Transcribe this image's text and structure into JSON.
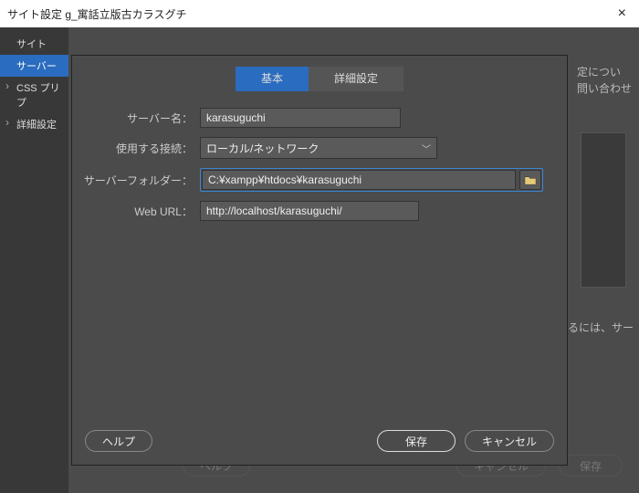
{
  "title": "サイト設定 g_寓話立版古カラスグチ",
  "sidebar": {
    "items": [
      {
        "label": "サイト"
      },
      {
        "label": "サーバー"
      },
      {
        "label": "CSS プリプ"
      },
      {
        "label": "詳細設定"
      }
    ]
  },
  "bg": {
    "line1": "定につい",
    "line2": "問い合わせ",
    "line3": "するには、サー",
    "help": "ヘルプ",
    "cancel": "キャンセル",
    "save": "保存"
  },
  "tabs": {
    "basic": "基本",
    "advanced": "詳細設定"
  },
  "form": {
    "server_name_label": "サーバー名：",
    "server_name_value": "karasuguchi",
    "connection_label": "使用する接続：",
    "connection_value": "ローカル/ネットワーク",
    "folder_label": "サーバーフォルダー：",
    "folder_value": "C:¥xampp¥htdocs¥karasuguchi",
    "weburl_label": "Web URL：",
    "weburl_value": "http://localhost/karasuguchi/"
  },
  "buttons": {
    "help": "ヘルプ",
    "save": "保存",
    "cancel": "キャンセル"
  }
}
